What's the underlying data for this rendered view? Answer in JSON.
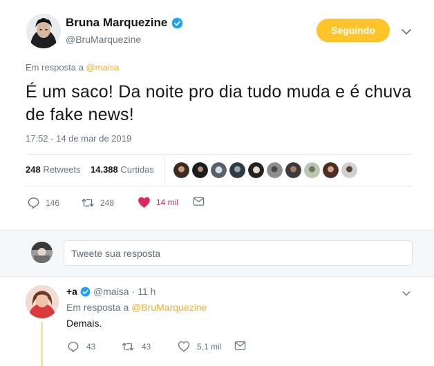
{
  "colors": {
    "accent": "#ffc429",
    "mention": "#ffad1f",
    "like": "#e0245e",
    "verified": "#1da1f2",
    "secondary_text": "#657786"
  },
  "tweet": {
    "author_name": "Bruna Marquezine",
    "author_handle": "@BruMarquezine",
    "follow_label": "Seguindo",
    "reply_to_prefix": "Em resposta a",
    "reply_to_mention": "@maisa",
    "text": "É um saco! Da noite pro dia tudo muda e é chuva de fake news!",
    "timestamp": "17:52 - 14 de mar de 2019",
    "stats": {
      "retweets_count": "248",
      "retweets_label": "Retweets",
      "likes_count": "14.388",
      "likes_label": "Curtidas"
    },
    "actions": {
      "replies": "146",
      "retweets": "248",
      "likes": "14 mil"
    },
    "icons": [
      "verified-badge-icon",
      "chevron-down-icon",
      "reply-icon",
      "retweet-icon",
      "heart-icon",
      "message-icon"
    ]
  },
  "reply_box": {
    "placeholder": "Tweete sua resposta"
  },
  "reply_tweet": {
    "author_name": "+a",
    "author_handle": "@maisa",
    "time": "11 h",
    "reply_to_prefix": "Em resposta a",
    "reply_to_mention": "@BruMarquezine",
    "text": "Demais.",
    "actions": {
      "replies": "43",
      "retweets": "43",
      "likes": "5,1 mil"
    }
  }
}
